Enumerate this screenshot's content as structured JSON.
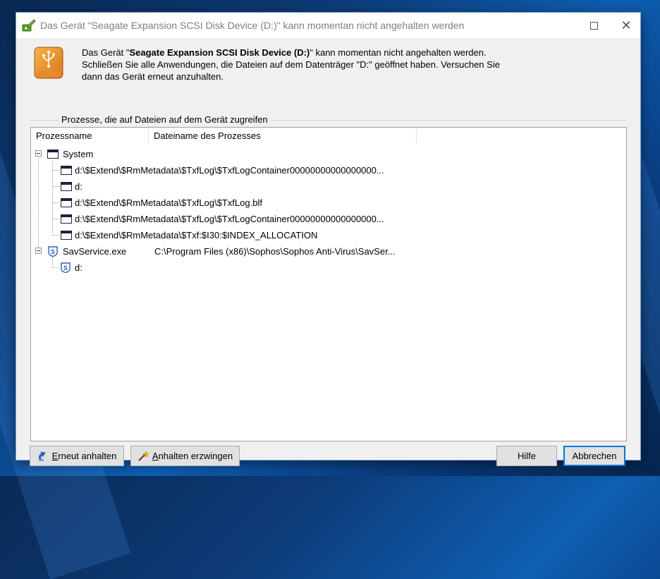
{
  "window": {
    "title": "Das Gerät \"Seagate Expansion SCSI Disk Device (D:)\" kann momentan nicht angehalten werden"
  },
  "message": {
    "prefix": "Das Gerät \"",
    "device_name": "Seagate Expansion SCSI Disk Device (D:)",
    "suffix": "\" kann momentan nicht angehalten werden.",
    "instruction": "Schließen Sie alle Anwendungen, die Dateien auf dem Datenträger \"D:\" geöffnet haben. Versuchen Sie dann das Gerät erneut anzuhalten."
  },
  "group": {
    "label": "Prozesse, die auf Dateien auf dem Gerät zugreifen"
  },
  "columns": {
    "process_name": "Prozessname",
    "process_file": "Dateiname des Prozesses"
  },
  "tree": {
    "system": {
      "name": "System",
      "file": "",
      "children": [
        "d:\\$Extend\\$RmMetadata\\$TxfLog\\$TxfLogContainer00000000000000000...",
        "d:",
        "d:\\$Extend\\$RmMetadata\\$TxfLog\\$TxfLog.blf",
        "d:\\$Extend\\$RmMetadata\\$TxfLog\\$TxfLogContainer00000000000000000...",
        "d:\\$Extend\\$RmMetadata\\$Txf:$I30:$INDEX_ALLOCATION"
      ]
    },
    "savservice": {
      "name": "SavService.exe",
      "file": "C:\\Program Files (x86)\\Sophos\\Sophos Anti-Virus\\SavSer...",
      "children": [
        "d:"
      ]
    }
  },
  "buttons": {
    "retry_first": "E",
    "retry_rest": "rneut anhalten",
    "force_first": "A",
    "force_rest": "nhalten erzwingen",
    "help": "Hilfe",
    "cancel": "Abbrechen"
  },
  "colors": {
    "accent": "#0078d7",
    "dialog_bg": "#f0f0f0"
  }
}
